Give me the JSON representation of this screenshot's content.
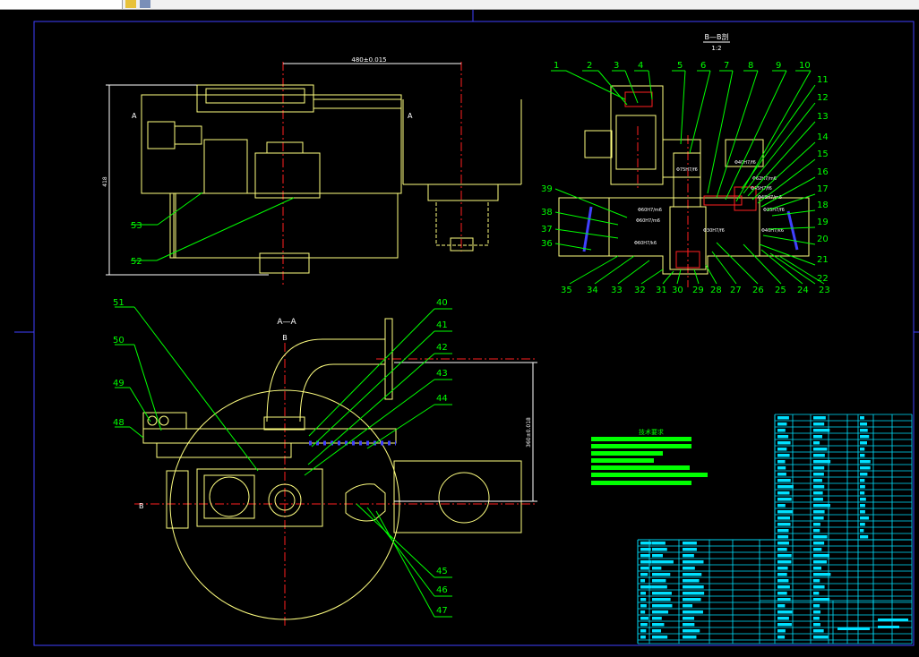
{
  "colors": {
    "background": "#000000",
    "frame": "#4040ff",
    "outline": "#ffff80",
    "centerline": "#ff2020",
    "leader": "#00ff00",
    "dimension": "#ffffff",
    "table": "#00e0ff",
    "hatch": "#4040ff",
    "notes": "#00ff00"
  },
  "views": {
    "front_dimension": "480±0.015",
    "front_height": "418",
    "section_label_a": "A",
    "section_aa_title": "A—A",
    "section_bb_title": "B—B剖",
    "section_bb_scale": "1:2",
    "cutting_label_b": "B",
    "center_distance": "360±0.018"
  },
  "balloons_left": [
    "53",
    "52",
    "51",
    "50",
    "49",
    "48",
    "40",
    "41",
    "42",
    "43",
    "44",
    "45",
    "46",
    "47"
  ],
  "balloons_top": [
    "1",
    "2",
    "3",
    "4",
    "5",
    "6",
    "7",
    "8",
    "9",
    "10"
  ],
  "balloons_right": [
    "11",
    "12",
    "13",
    "14",
    "15",
    "16",
    "17",
    "18",
    "19",
    "20",
    "21",
    "22"
  ],
  "balloons_bottom": [
    "35",
    "34",
    "33",
    "32",
    "31",
    "30",
    "29",
    "28",
    "27",
    "26",
    "25",
    "24",
    "23"
  ],
  "balloons_side": [
    "39",
    "38",
    "37",
    "36"
  ],
  "fits": [
    "Φ60H7/m6",
    "Φ75H7/f6",
    "Φ40H7/f6",
    "Φ62H7/m6",
    "Φ45H7/f6",
    "Φ48H7/m6",
    "Φ35H7/f6",
    "Φ60H7/m6",
    "Φ40H7/k6",
    "Φ60H7/k6",
    "Φ30H7/f6"
  ],
  "notes": {
    "title": "技术要求"
  }
}
